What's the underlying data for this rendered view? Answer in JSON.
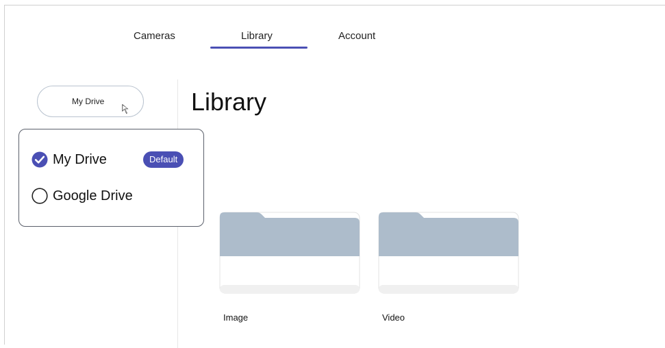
{
  "nav": {
    "tabs": [
      {
        "label": "Cameras"
      },
      {
        "label": "Library",
        "active": true
      },
      {
        "label": "Account"
      }
    ]
  },
  "storage": {
    "button_label": "My Drive",
    "options": [
      {
        "label": "My Drive",
        "selected": true,
        "badge": "Default"
      },
      {
        "label": "Google Drive",
        "selected": false
      }
    ]
  },
  "library": {
    "title": "Library",
    "folders": [
      {
        "label": "Image"
      },
      {
        "label": "Video"
      }
    ]
  },
  "colors": {
    "accent": "#4a4fb4",
    "folder_tab": "#adbccb",
    "folder_body": "#ffffff",
    "border": "#5a5f6a"
  },
  "icons": {
    "cursor": "mouse-pointer-icon",
    "checked": "check-circle-icon",
    "unchecked": "radio-empty-icon",
    "folder": "folder-icon"
  }
}
